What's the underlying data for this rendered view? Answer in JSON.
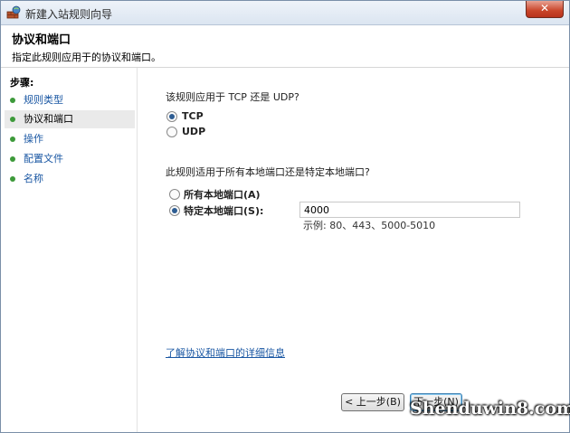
{
  "window": {
    "title": "新建入站规则向导",
    "close_label": "✕"
  },
  "header": {
    "title": "协议和端口",
    "subtitle": "指定此规则应用于的协议和端口。"
  },
  "sidebar": {
    "title": "步骤:",
    "items": [
      {
        "label": "规则类型",
        "active": false
      },
      {
        "label": "协议和端口",
        "active": true
      },
      {
        "label": "操作",
        "active": false
      },
      {
        "label": "配置文件",
        "active": false
      },
      {
        "label": "名称",
        "active": false
      }
    ]
  },
  "protocol": {
    "question": "该规则应用于 TCP 还是 UDP?",
    "options": [
      {
        "label": "TCP",
        "checked": true
      },
      {
        "label": "UDP",
        "checked": false
      }
    ]
  },
  "ports": {
    "question": "此规则适用于所有本地端口还是特定本地端口?",
    "options": [
      {
        "label": "所有本地端口(A)",
        "checked": false
      },
      {
        "label": "特定本地端口(S):",
        "checked": true
      }
    ],
    "value": "4000",
    "example": "示例: 80、443、5000-5010"
  },
  "link": "了解协议和端口的详细信息",
  "buttons": {
    "back": "< 上一步(B)",
    "next": "下一步(N)"
  },
  "watermark": "Shenduwin8.com"
}
